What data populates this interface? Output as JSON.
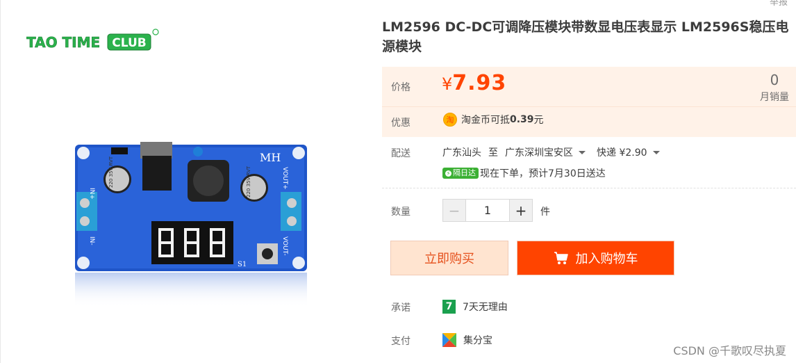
{
  "report_link": "举报",
  "logo": {
    "text_a": "TAO TIME",
    "text_b": "CLUB"
  },
  "product": {
    "title": "LM2596 DC-DC可调降压模块带数显电压表显示 LM2596S稳压电源模块",
    "image_texts": {
      "mh": "MH",
      "in_plus": "IN+",
      "in_minus": "IN-",
      "vout_plus": "VOUT+",
      "vout_minus": "VOUT-",
      "s1": "S1",
      "cap": "220 35V RVT"
    }
  },
  "price": {
    "label": "价格",
    "currency": "¥",
    "value": "7.93"
  },
  "sales": {
    "count": "0",
    "label": "月销量"
  },
  "promo": {
    "label": "优惠",
    "coin_icon": "淘",
    "text": "淘金币可抵",
    "amount": "0.39",
    "unit": "元"
  },
  "shipping": {
    "label": "配送",
    "from": "广东汕头",
    "to_word": "至",
    "to": "广东深圳宝安区",
    "method": "快递 ¥2.90",
    "badge": "隔日达",
    "delivery_text": "现在下单，预计7月30日送达"
  },
  "quantity": {
    "label": "数量",
    "minus": "−",
    "value": "1",
    "plus": "+",
    "unit": "件"
  },
  "buttons": {
    "buy_now": "立即购买",
    "add_cart": "加入购物车"
  },
  "promise": {
    "label": "承诺",
    "icon": "7",
    "text": "7天无理由"
  },
  "payment": {
    "label": "支付",
    "text": "集分宝"
  },
  "watermark": "CSDN @千歌叹尽执夏",
  "colors": {
    "accent": "#ff4400",
    "price_bg": "#fff2e8",
    "buy_bg": "#ffe4d0",
    "green": "#3cb034",
    "logo_green": "#2bb24c"
  }
}
